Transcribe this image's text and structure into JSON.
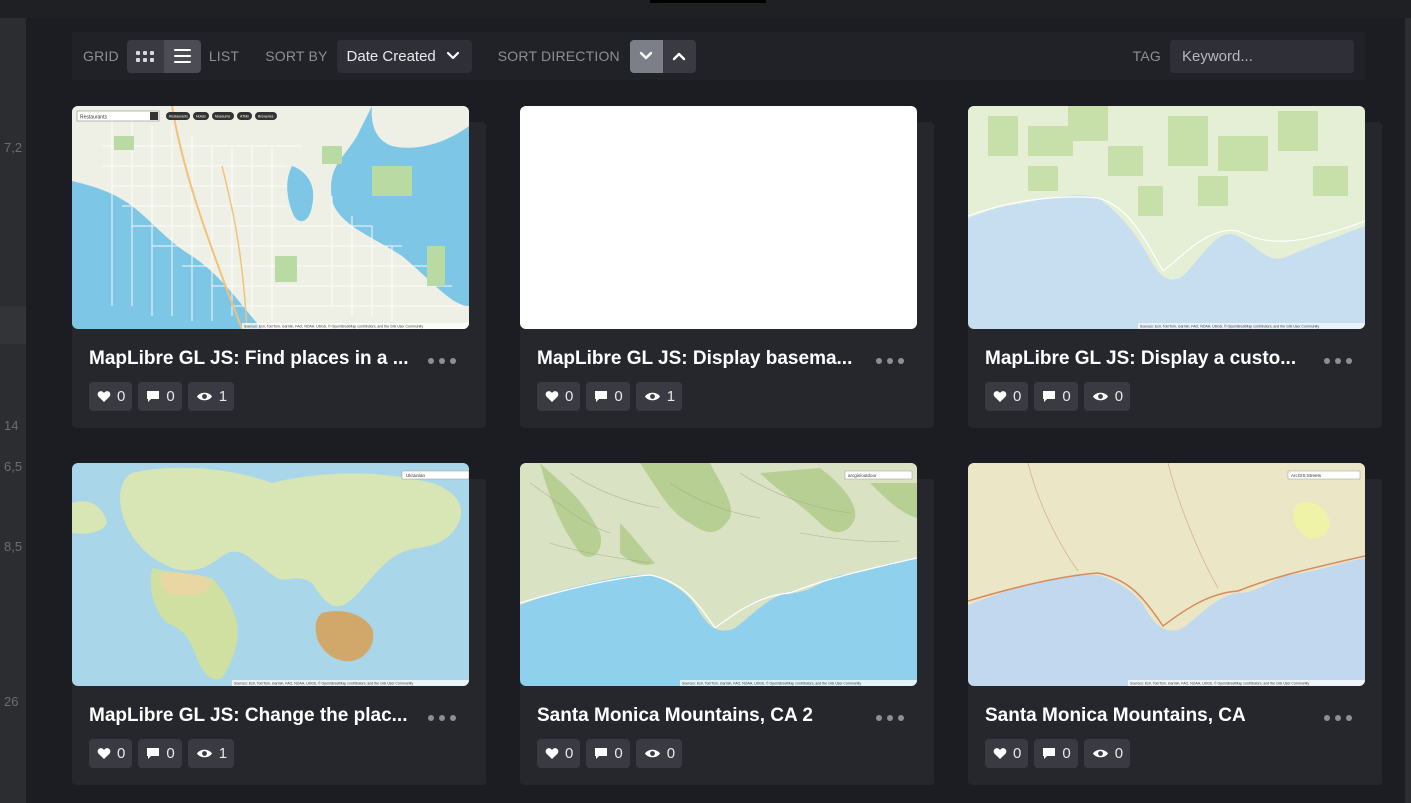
{
  "toolbar": {
    "grid_label": "GRID",
    "list_label": "LIST",
    "sort_by_label": "SORT BY",
    "sort_by_value": "Date Created",
    "sort_direction_label": "SORT DIRECTION",
    "tag_label": "TAG",
    "tag_placeholder": "Keyword..."
  },
  "background": {
    "numbers": [
      "7,2",
      "14",
      "6,5",
      "8,5",
      "26"
    ]
  },
  "cards": [
    {
      "title": "MapLibre GL JS: Find places in a ...",
      "likes": "0",
      "comments": "0",
      "views": "1",
      "thumbnail": "city-map-with-search"
    },
    {
      "title": "MapLibre GL JS: Display basema...",
      "likes": "0",
      "comments": "0",
      "views": "1",
      "thumbnail": "blank"
    },
    {
      "title": "MapLibre GL JS: Display a custo...",
      "likes": "0",
      "comments": "0",
      "views": "0",
      "thumbnail": "coastal-vector-map"
    },
    {
      "title": "MapLibre GL JS: Change the plac...",
      "likes": "0",
      "comments": "0",
      "views": "1",
      "thumbnail": "world-imagery-map"
    },
    {
      "title": "Santa Monica Mountains, CA 2",
      "likes": "0",
      "comments": "0",
      "views": "0",
      "thumbnail": "terrain-coastal-map"
    },
    {
      "title": "Santa Monica Mountains, CA",
      "likes": "0",
      "comments": "0",
      "views": "0",
      "thumbnail": "streets-coastal-map"
    }
  ],
  "map_text": {
    "search_placeholder": "Restaurants",
    "chip_1": "Restaurants",
    "chip_2": "Hotels",
    "chip_3": "Museums",
    "chip_4": "ATMs",
    "chip_5": "Breweries",
    "select_world": "Ukrainian",
    "select_terrain": "arcgis/outdoor",
    "select_streets": "ArcGIS:Streets",
    "attribution": "Sources: Esri, TomTom, Garmin, FAO, NOAA, USGS, © OpenStreetMap contributors, and the GIS User Community"
  },
  "colors": {
    "accent_active": "#7c7e88",
    "water": "#7ec6e6",
    "land": "#eef0e6"
  }
}
